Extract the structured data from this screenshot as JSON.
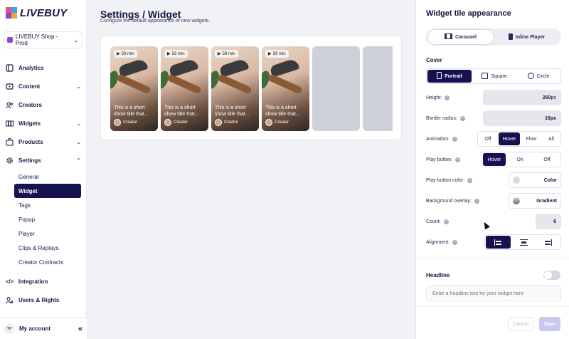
{
  "app": {
    "logo_text": "LIVEBUY",
    "logo_colors": [
      "#e84a8a",
      "#3ba7e8",
      "#8e44d8",
      "#f5a623"
    ]
  },
  "sidebar": {
    "shop_selector": "LIVEBUY Shop - Prod",
    "items": [
      {
        "label": "Analytics",
        "icon": "analytics-icon"
      },
      {
        "label": "Content",
        "icon": "content-icon",
        "expandable": true
      },
      {
        "label": "Creators",
        "icon": "creators-icon"
      },
      {
        "label": "Widgets",
        "icon": "widgets-icon",
        "expandable": true
      },
      {
        "label": "Products",
        "icon": "products-icon",
        "expandable": true
      },
      {
        "label": "Settings",
        "icon": "gear-icon",
        "expandable": true,
        "expanded": true
      }
    ],
    "settings_sub": [
      "General",
      "Widget",
      "Tags",
      "Popup",
      "Player",
      "Clips & Replays",
      "Creator Contracts"
    ],
    "active_sub": "Widget",
    "bottom_items": [
      {
        "label": "Integration",
        "icon": "code-icon"
      },
      {
        "label": "Users & Rights",
        "icon": "users-icon"
      }
    ],
    "account": {
      "initials": "TP",
      "label": "My account"
    }
  },
  "main": {
    "title": "Settings / Widget",
    "subtitle": "Configure the default appearance of new widgets.",
    "tiles": [
      {
        "duration": "59 min",
        "caption": "This is a short show title that...",
        "creator": "Creator"
      },
      {
        "duration": "59 min",
        "caption": "This is a short show title that...",
        "creator": "Creator"
      },
      {
        "duration": "59 min",
        "caption": "This is a short show title that...",
        "creator": "Creator"
      },
      {
        "duration": "59 min",
        "caption": "This is a short show title that...",
        "creator": "Creator"
      }
    ]
  },
  "panel": {
    "title": "Widget tile appearance",
    "modes": [
      "Carousel",
      "Inline Player"
    ],
    "active_mode": "Carousel",
    "cover_label": "Cover",
    "cover_options": [
      "Portrait",
      "Square",
      "Circle"
    ],
    "active_cover": "Portrait",
    "height": {
      "label": "Height:",
      "value": "260",
      "unit": "px"
    },
    "border_radius": {
      "label": "Border radius:",
      "value": "16px"
    },
    "animation": {
      "label": "Animation:",
      "options": [
        "Off",
        "Hover",
        "Flow",
        "All"
      ],
      "active": "Hover"
    },
    "play_button": {
      "label": "Play button:",
      "options": [
        "Hover",
        "On",
        "Off"
      ],
      "active": "Hover"
    },
    "play_button_color": {
      "label": "Play button color:",
      "value": "Color",
      "swatch": "#d9d9de"
    },
    "background_overlay": {
      "label": "Background overlay:",
      "value": "Gradient",
      "swatch": "#9c9aa3"
    },
    "count": {
      "label": "Count:",
      "value": "6"
    },
    "alignment": {
      "label": "Alignment:",
      "options": [
        "left",
        "center",
        "right"
      ],
      "active": "left"
    },
    "headline": {
      "label": "Headline",
      "enabled": false,
      "placeholder": "Enter a headline text for your widget here"
    },
    "cancel_label": "Cancel",
    "save_label": "Save",
    "accent": "#15124f"
  }
}
